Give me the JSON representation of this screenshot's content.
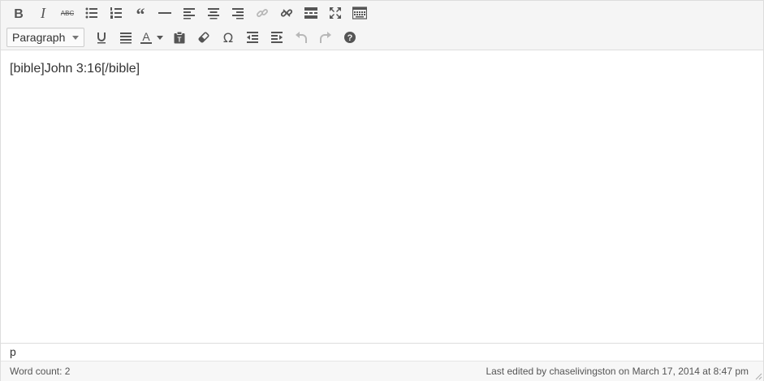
{
  "toolbar": {
    "format_select": {
      "selected": "Paragraph"
    },
    "icons_row1": [
      "bold-icon",
      "italic-icon",
      "strikethrough-icon",
      "bullet-list-icon",
      "numbered-list-icon",
      "blockquote-icon",
      "horizontal-rule-icon",
      "align-left-icon",
      "align-center-icon",
      "align-right-icon",
      "link-icon",
      "unlink-icon",
      "read-more-icon",
      "fullscreen-icon",
      "toolbar-toggle-icon"
    ],
    "icons_row2": [
      "underline-icon",
      "justify-icon",
      "text-color-icon",
      "paste-text-icon",
      "clear-formatting-icon",
      "special-character-icon",
      "outdent-icon",
      "indent-icon",
      "undo-icon",
      "redo-icon",
      "help-icon"
    ]
  },
  "content": {
    "text": "[bible]John 3:16[/bible]"
  },
  "path": {
    "element": "p"
  },
  "status": {
    "word_count": "Word count: 2",
    "last_edited": "Last edited by chaselivingston on March 17, 2014 at 8:47 pm"
  },
  "colors": {
    "icon": "#555555",
    "icon_disabled": "#b8b8b8",
    "toolbar_bg": "#f5f5f5",
    "border": "#dddddd"
  }
}
